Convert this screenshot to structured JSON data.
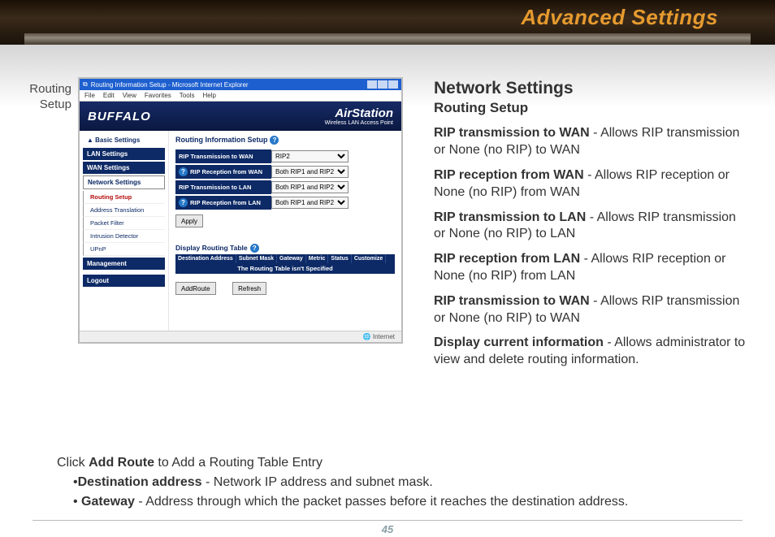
{
  "header": {
    "title": "Advanced Settings"
  },
  "caption": "Routing Setup",
  "screenshot": {
    "window_title": "Routing Information Setup - Microsoft Internet Explorer",
    "menu": [
      "File",
      "Edit",
      "View",
      "Favorites",
      "Tools",
      "Help"
    ],
    "brand": "BUFFALO",
    "brand_product": "AirStation",
    "brand_sub": "Wireless LAN Access Point",
    "sidebar": {
      "basic": "▲ Basic Settings",
      "items": [
        "LAN Settings",
        "WAN Settings",
        "Network Settings"
      ],
      "subs": [
        "Routing Setup",
        "Address Translation",
        "Packet Filter",
        "Intrusion Detector",
        "UPnP"
      ],
      "bottom": [
        "Management",
        "Logout"
      ]
    },
    "main": {
      "title": "Routing Information Setup",
      "rows": [
        {
          "label": "RIP Transmission to WAN",
          "value": "RIP2"
        },
        {
          "label": "RIP Reception from WAN",
          "value": "Both RIP1 and RIP2"
        },
        {
          "label": "RIP Transmission to LAN",
          "value": "Both RIP1 and RIP2"
        },
        {
          "label": "RIP Reception from LAN",
          "value": "Both RIP1 and RIP2"
        }
      ],
      "apply": "Apply",
      "drt": "Display Routing Table",
      "cols": [
        "Destination Address",
        "Subnet Mask",
        "Gateway",
        "Metric",
        "Status",
        "Customize"
      ],
      "empty": "The Routing Table isn't Specified",
      "add": "AddRoute",
      "refresh": "Refresh"
    },
    "status": "Internet"
  },
  "right": {
    "heading": "Network Settings",
    "subheading": "Routing Setup",
    "paras": [
      {
        "b": "RIP transmission to WAN",
        "t": " - Allows RIP transmission or None (no RIP) to WAN"
      },
      {
        "b": "RIP reception from WAN",
        "t": " - Allows RIP reception or None (no RIP) from WAN"
      },
      {
        "b": "RIP transmission to LAN",
        "t": " - Allows RIP transmission or None (no RIP) to LAN"
      },
      {
        "b": "RIP reception from LAN",
        "t": " - Allows RIP reception or None (no RIP) from LAN"
      },
      {
        "b": "RIP transmission to WAN",
        "t": " - Allows RIP transmission or None (no RIP) to WAN"
      },
      {
        "b": "Display current information",
        "t": " - Allows administrator to view and delete routing information."
      }
    ]
  },
  "bottom": {
    "line1_a": "Click ",
    "line1_b": "Add Route",
    "line1_c": " to Add a Routing Table Entry",
    "bullet1_b": "Destination address",
    "bullet1_t": " - Network IP address and subnet mask.",
    "bullet2_b": " Gateway",
    "bullet2_t": " - Address through which the packet passes before it reaches the destination address."
  },
  "page": "45"
}
